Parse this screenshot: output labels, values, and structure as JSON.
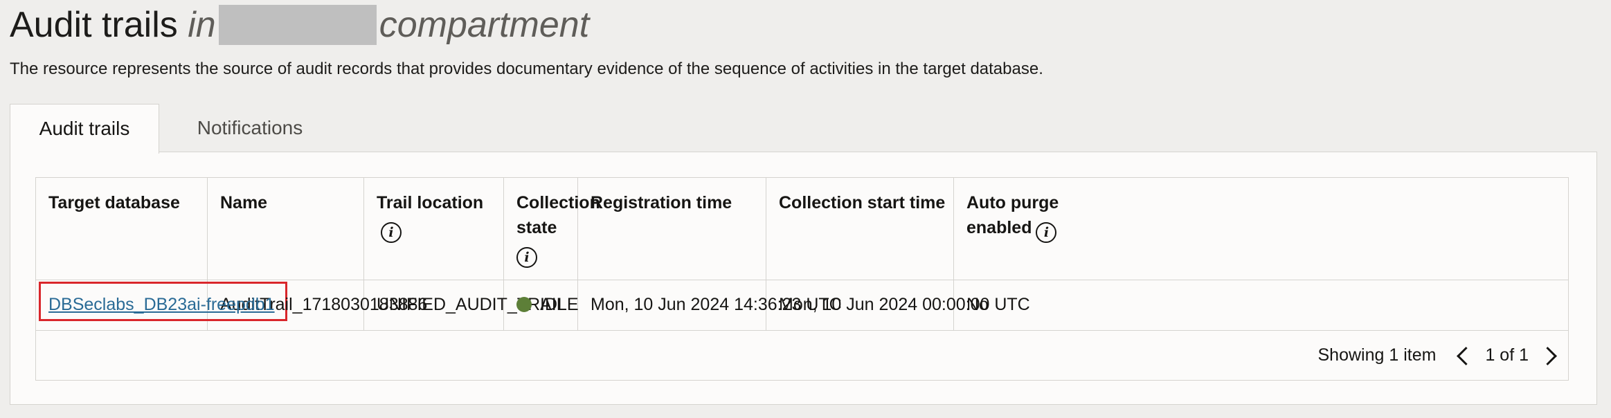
{
  "header": {
    "title_main": "Audit trails",
    "title_in": "in",
    "title_suffix": "compartment",
    "description": "The resource represents the source of audit records that provides documentary evidence of the sequence of activities in the target database."
  },
  "tabs": [
    {
      "label": "Audit trails",
      "active": true
    },
    {
      "label": "Notifications",
      "active": false
    }
  ],
  "table": {
    "columns": [
      {
        "label": "Target database",
        "info": false
      },
      {
        "label": "Name",
        "info": false
      },
      {
        "label": "Trail location",
        "info": true
      },
      {
        "label": "Collection state",
        "info": true
      },
      {
        "label": "Registration time",
        "info": false
      },
      {
        "label": "Collection start time",
        "info": false
      },
      {
        "label": "Auto purge enabled",
        "info": true
      }
    ],
    "rows": [
      {
        "target_database": "DBSeclabs_DB23ai-freepdb1",
        "name": "AuditTrail_1718030183886",
        "trail_location": "UNIFIED_AUDIT_TRAIL",
        "collection_state": "IDLE",
        "registration_time": "Mon, 10 Jun 2024 14:36:23 UTC",
        "collection_start_time": "Mon, 10 Jun 2024 00:00:00 UTC",
        "auto_purge_enabled": "No"
      }
    ]
  },
  "pagination": {
    "showing": "Showing 1 item",
    "page": "1 of 1"
  },
  "colors": {
    "link": "#2a6b96",
    "status_idle": "#5d7f38",
    "highlight": "#d9262b"
  },
  "icons": [
    "info-icon",
    "status-dot-icon",
    "chevron-left-icon",
    "chevron-right-icon"
  ]
}
